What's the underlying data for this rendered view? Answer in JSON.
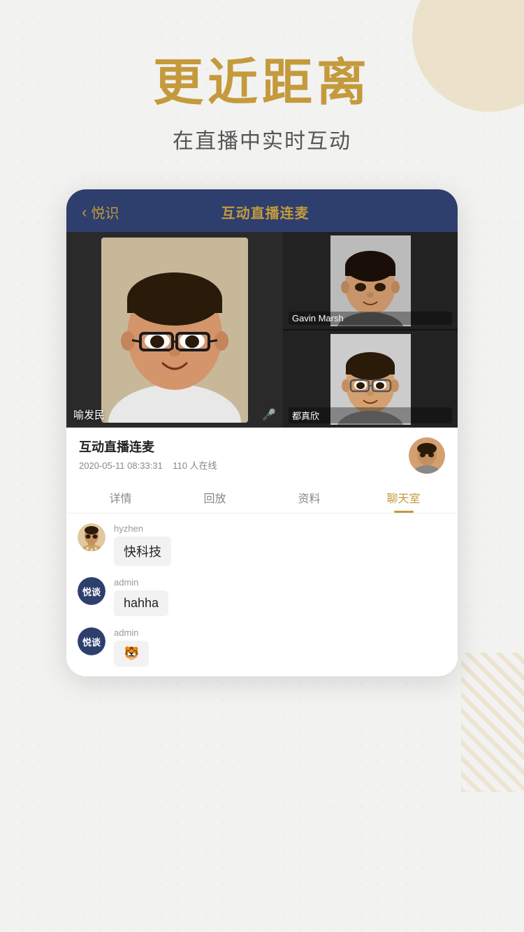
{
  "background": {
    "dotPattern": true
  },
  "hero": {
    "title": "更近距离",
    "subtitle": "在直播中实时互动"
  },
  "phone": {
    "header": {
      "backLabel": "悦识",
      "title": "互动直播连麦"
    },
    "videoGrid": {
      "mainPerson": {
        "name": "喻发民",
        "hasMic": true
      },
      "sidePerson1": {
        "name": "Gavin Marsh"
      },
      "sidePerson2": {
        "name": "都真欣"
      }
    },
    "infoRow": {
      "title": "互动直播连麦",
      "date": "2020-05-11 08:33:31",
      "online": "110 人在线"
    },
    "tabs": [
      {
        "label": "详情",
        "active": false
      },
      {
        "label": "回放",
        "active": false
      },
      {
        "label": "资料",
        "active": false
      },
      {
        "label": "聊天室",
        "active": true
      }
    ],
    "chat": {
      "messages": [
        {
          "username": "hyzhen",
          "avatarType": "photo",
          "message": "快科技"
        },
        {
          "username": "admin",
          "avatarType": "badge",
          "badgeText": "悦谈",
          "message": "hahha"
        },
        {
          "username": "admin",
          "avatarType": "badge",
          "badgeText": "悦谈",
          "message": "🐯"
        }
      ]
    }
  }
}
